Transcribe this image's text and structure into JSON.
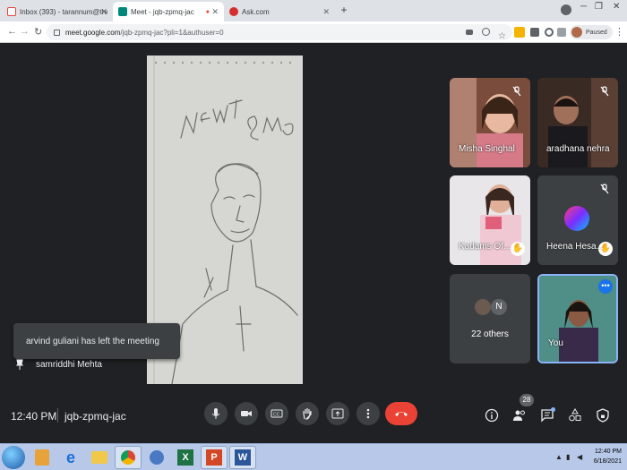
{
  "browser": {
    "tabs": [
      {
        "label": "Inbox (393) - tarannum@theindi",
        "icon": "gmail-icon",
        "color": "#ea4335"
      },
      {
        "label": "Meet - jqb-zpmq-jac",
        "icon": "meet-icon",
        "color": "#00897b"
      },
      {
        "label": "Ask.com",
        "icon": "ask-icon",
        "color": "#d32f2f"
      }
    ],
    "url_host": "meet.google.com",
    "url_path": "/jqb-zpmq-jac?pli=1&authuser=0",
    "profile_status": "Paused"
  },
  "participants": [
    {
      "name": "Misha Singhal",
      "muted": true
    },
    {
      "name": "aradhana nehra",
      "muted": true
    },
    {
      "name": "Kadams Of...",
      "muted": false,
      "hand_raised": true
    },
    {
      "name": "Heena Hesa...",
      "muted": true,
      "hand_raised": true
    },
    {
      "name": "22 others",
      "initial": "N"
    },
    {
      "name": "You"
    }
  ],
  "presenter": {
    "name": "samriddhi Mehta"
  },
  "notification": "arvind guliani has left the meeting",
  "meeting": {
    "time": "12:40 PM",
    "code": "jqb-zpmq-jac",
    "participant_count": "28"
  },
  "taskbar": {
    "time": "12:40 PM",
    "date": "6/18/2021"
  },
  "colors": {
    "end_call": "#ea4335",
    "self_tile_border": "#8ab4f8",
    "bg": "#202124"
  }
}
